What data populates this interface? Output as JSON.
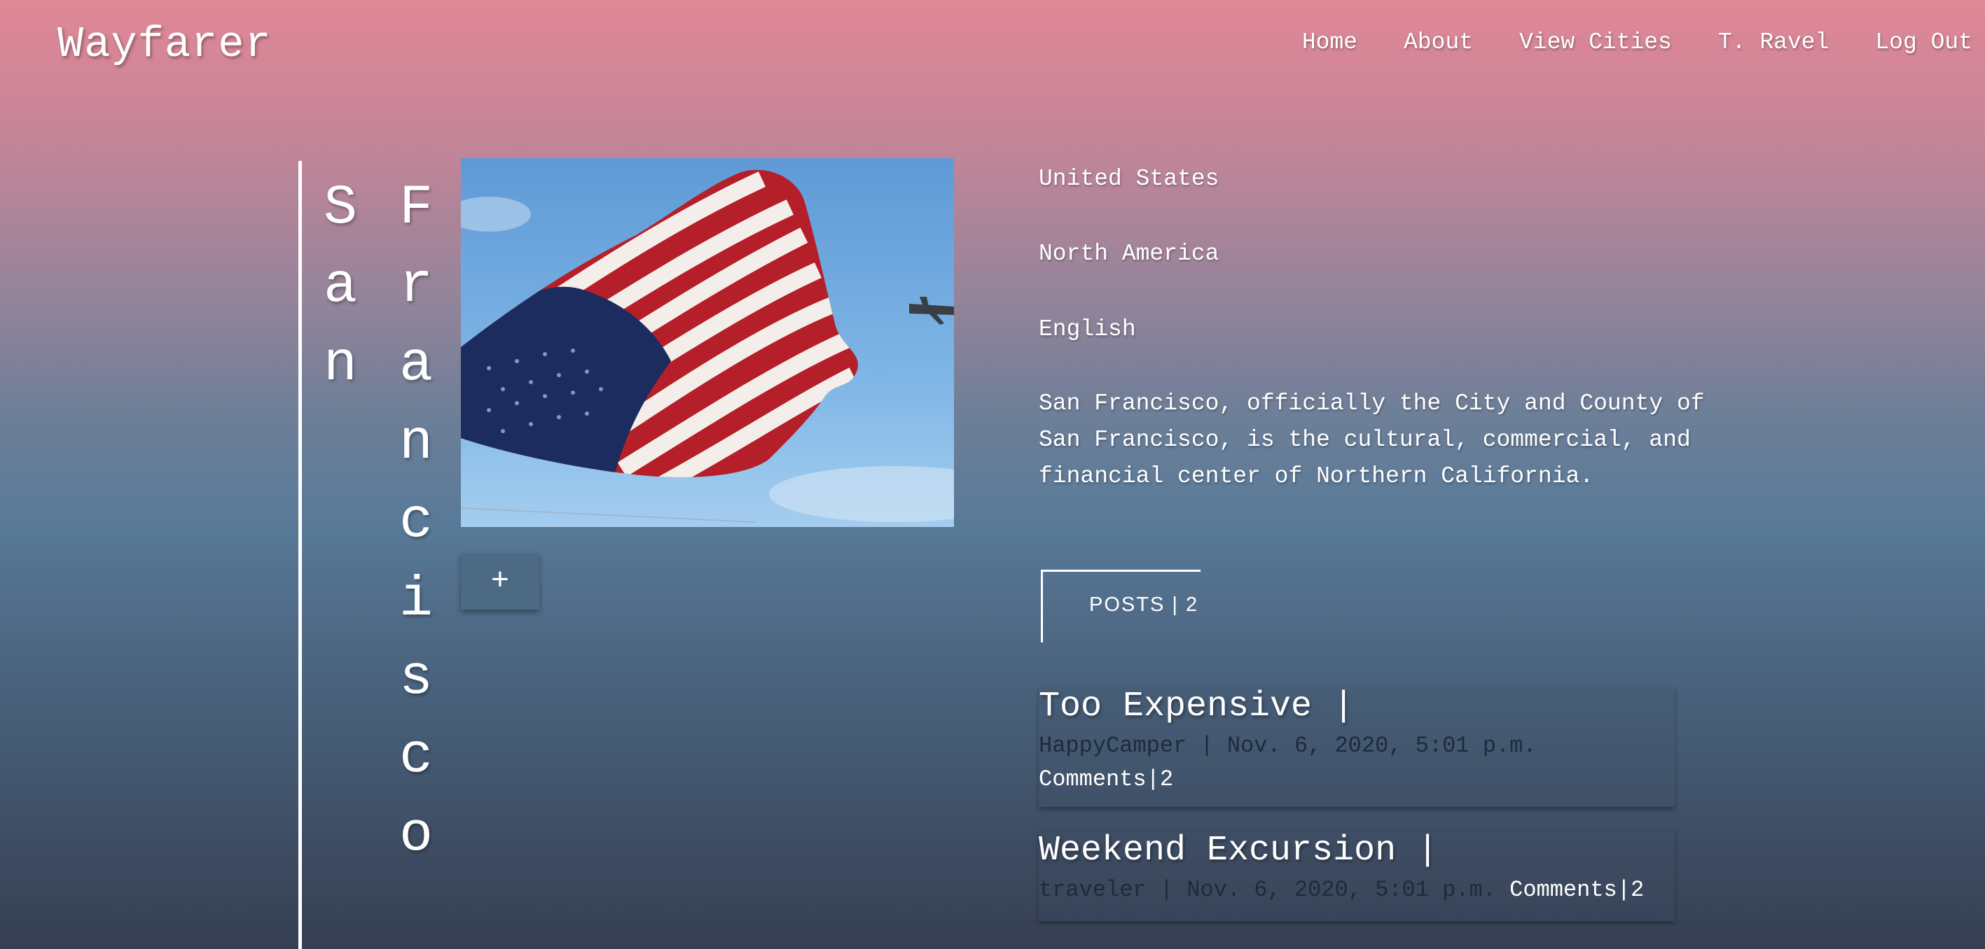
{
  "header": {
    "logo": "Wayfarer",
    "nav": [
      "Home",
      "About",
      "View Cities",
      "T. Ravel",
      "Log Out"
    ]
  },
  "city": {
    "name_words": [
      [
        "S",
        "a",
        "n"
      ],
      [
        "F",
        "r",
        "a",
        "n",
        "c",
        "i",
        "s",
        "c",
        "o"
      ]
    ],
    "add_button": "+",
    "country": "United States",
    "continent": "North America",
    "language": "English",
    "description": "San Francisco, officially the City and County of San Francisco, is the cultural, commercial, and financial center of Northern California."
  },
  "posts": {
    "label": "POSTS | 2",
    "items": [
      {
        "title": "Too Expensive |",
        "meta": "HappyCamper | Nov. 6, 2020, 5:01 p.m.",
        "comments": "Comments|2"
      },
      {
        "title": "Weekend Excursion |",
        "meta": "traveler | Nov. 6, 2020, 5:01 p.m.",
        "comments": "Comments|2"
      }
    ]
  },
  "colors": {
    "gradient_top": "#e08796",
    "gradient_mid": "#587a98",
    "gradient_bottom": "#363f52",
    "button_bg": "#4d6a85",
    "meta_text": "#1f2a3a"
  }
}
